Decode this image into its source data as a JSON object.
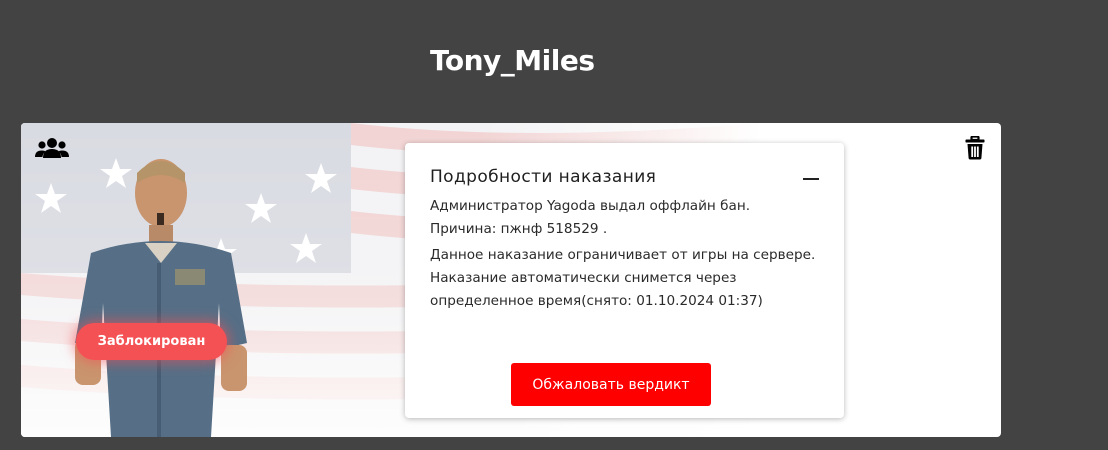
{
  "player": {
    "name": "Tony_Miles"
  },
  "card": {
    "status_badge": "Заблокирован",
    "icons": {
      "group": "users-icon",
      "delete": "trash-icon"
    }
  },
  "punishment": {
    "title": "Подробности наказания",
    "issued_line": "Администратор Yagoda выдал оффлайн бан.",
    "reason_line": "Причина: пжнф 518529 .",
    "note": "Данное наказание ограничивает от игры на сервере. Наказание автоматически снимется через определенное время(снято: 01.10.2024 01:37)",
    "appeal_label": "Обжаловать вердикт"
  },
  "colors": {
    "page_background": "#434344",
    "badge": "#f45155",
    "appeal_button": "#ff0000"
  }
}
